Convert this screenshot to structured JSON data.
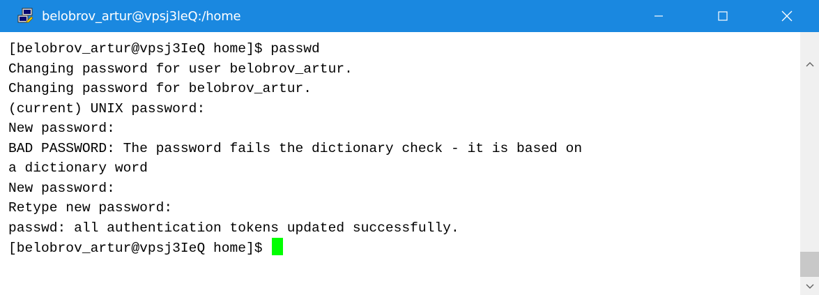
{
  "window": {
    "title": "belobrov_artur@vpsj3leQ:/home",
    "app_icon": "putty-icon",
    "controls": {
      "minimize_icon": "minimize-icon",
      "maximize_icon": "maximize-icon",
      "close_icon": "close-icon"
    }
  },
  "terminal": {
    "lines": [
      "[belobrov_artur@vpsj3IeQ home]$ passwd",
      "Changing password for user belobrov_artur.",
      "Changing password for belobrov_artur.",
      "(current) UNIX password:",
      "New password:",
      "BAD PASSWORD: The password fails the dictionary check - it is based on",
      "a dictionary word",
      "New password:",
      "Retype new password:",
      "passwd: all authentication tokens updated successfully."
    ],
    "prompt": "[belobrov_artur@vpsj3IeQ home]$ ",
    "cursor_color": "#00ff00"
  },
  "colors": {
    "titlebar": "#1a88e0",
    "terminal_bg": "#ffffff",
    "terminal_fg": "#000000"
  }
}
